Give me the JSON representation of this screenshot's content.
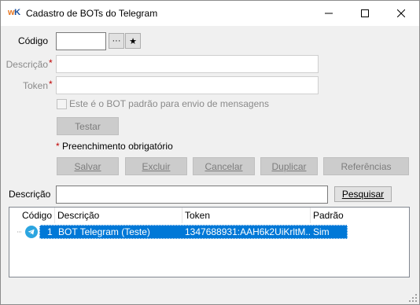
{
  "window": {
    "logo_w": "w",
    "logo_k": "K",
    "title": "Cadastro de BOTs do Telegram"
  },
  "form": {
    "codigo_label": "Código",
    "codigo_value": "",
    "descricao_label": "Descrição",
    "token_label": "Token",
    "required_mark": "*",
    "default_checkbox_label": "Este é o BOT padrão para envio de mensagens",
    "default_checked": false,
    "testar_label": "Testar",
    "required_note": "Preenchimento obrigatório"
  },
  "actions": {
    "salvar": "Salvar",
    "excluir": "Excluir",
    "cancelar": "Cancelar",
    "duplicar": "Duplicar",
    "referencias": "Referências"
  },
  "search": {
    "label": "Descrição",
    "value": "",
    "button": "Pesquisar"
  },
  "grid": {
    "columns": [
      "Código",
      "Descrição",
      "Token",
      "Padrão"
    ],
    "rows": [
      {
        "codigo": "1",
        "descricao": "BOT Telegram (Teste)",
        "token": "1347688931:AAH6k2UiKrltM...",
        "padrao": "Sim",
        "icon": "telegram-icon",
        "selected": true
      }
    ]
  },
  "colors": {
    "accent": "#0078d7",
    "required": "#c00000",
    "telegram": "#2ca5e0"
  }
}
